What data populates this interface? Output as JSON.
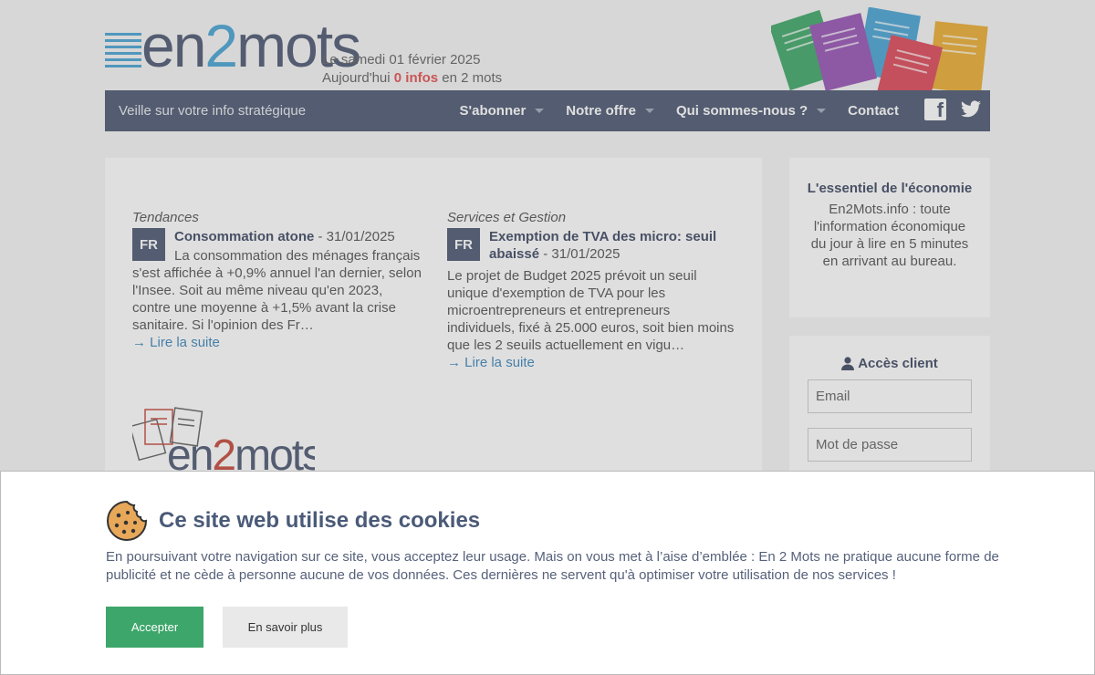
{
  "header": {
    "logo_text_a": "en",
    "logo_text_b": "2",
    "logo_text_c": "mots",
    "date_line": "Le samedi 01 février 2025",
    "today_prefix": "Aujourd'hui",
    "today_count": "0 infos",
    "today_suffix": "en 2 mots"
  },
  "nav": {
    "tagline": "Veille sur votre info stratégique",
    "items": [
      "S'abonner",
      "Notre offre",
      "Qui sommes-nous ?",
      "Contact"
    ],
    "social": [
      "facebook-icon",
      "twitter-icon"
    ]
  },
  "articles": [
    {
      "category": "Tendances",
      "flag": "FR",
      "title": "Consommation atone",
      "date": "- 31/01/2025",
      "excerpt": "La consommation des ménages français s'est affichée à +0,9% annuel l'an dernier, selon l'Insee. Soit au même niveau qu'en 2023, contre une moyenne à +1,5% avant la crise sanitaire. Si l'opinion des Fr…",
      "more": "→ Lire la suite"
    },
    {
      "category": "Services et Gestion",
      "flag": "FR",
      "title": "Exemption de TVA des micro: seuil abaissé",
      "date": "- 31/01/2025",
      "excerpt": "Le projet de Budget 2025 prévoit un seuil unique d'exemption de TVA pour les microentrepreneurs et entrepreneurs individuels, fixé à 25.000 euros, soit bien moins que les 2 seuils actuellement en vigu…",
      "more": "→ Lire la suite"
    }
  ],
  "sidebar": {
    "essentiel_title": "L'essentiel de l'économie",
    "essentiel_text": "En2Mots.info : toute l'information économique du jour à lire en 5 minutes en arrivant au bureau.",
    "access_title": "Accès client",
    "email_placeholder": "Email",
    "password_placeholder": "Mot de passe"
  },
  "cookie": {
    "title": "Ce site web utilise des cookies",
    "text": "En poursuivant votre navigation sur ce site, vous acceptez leur usage. Mais on vous met à l’aise d’emblée : En 2 Mots ne pratique aucune forme de publicité et ne cède à personne aucune de vos données. Ces dernières ne servent qu'à optimiser votre utilisation de nos services !",
    "accept": "Accepter",
    "learn_more": "En savoir plus"
  },
  "colors": {
    "nav_bg": "#3d4a66",
    "accent_red": "#e34040",
    "link": "#2a7bb5",
    "accept_green": "#3da66a"
  }
}
